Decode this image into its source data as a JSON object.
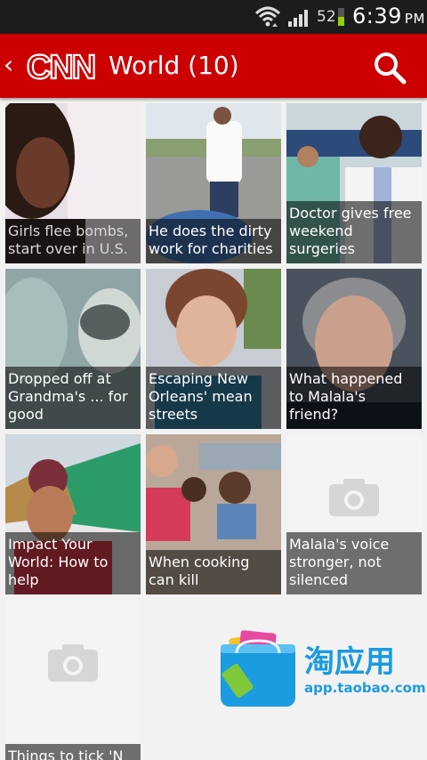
{
  "status": {
    "battery": "52",
    "battery_level": 0.52,
    "time": "6:39",
    "ampm": "PM"
  },
  "header": {
    "title": "World (10)",
    "logo_text": "CNN"
  },
  "tiles": [
    {
      "caption": "Girls flee bombs, start over in U.S."
    },
    {
      "caption": "He does the dirty work for charities"
    },
    {
      "caption": "Doctor gives free weekend surgeries"
    },
    {
      "caption": "Dropped off at Grandma's ... for good"
    },
    {
      "caption": "Escaping New Orleans' mean streets"
    },
    {
      "caption": "What happened to Malala's friend?"
    },
    {
      "caption": "Impact Your World: How to help"
    },
    {
      "caption": "When cooking can kill"
    },
    {
      "caption": "Malala's voice stronger, not silenced"
    },
    {
      "caption": "Things to tick 'N"
    }
  ],
  "overlay": {
    "cn_text": "淘应用",
    "url": "app.taobao.com"
  },
  "colors": {
    "accent": "#cc0000",
    "status_bg": "#1c1c1c"
  }
}
